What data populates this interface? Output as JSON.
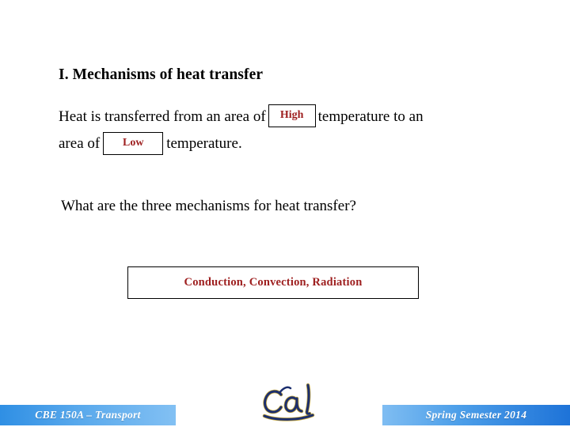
{
  "slide": {
    "title": "I. Mechanisms of heat transfer",
    "body": {
      "line1_part1": "Heat is transferred from an area of",
      "blank_high": "High",
      "line1_part2": "temperature to an",
      "line2_part1": "area of",
      "blank_low": "Low",
      "line2_part2": "temperature."
    },
    "question": "What are the three mechanisms for heat transfer?",
    "answer": "Conduction, Convection, Radiation"
  },
  "footer": {
    "course": "CBE 150A – Transport",
    "term": "Spring Semester 2014",
    "logo_text": "Cal"
  },
  "colors": {
    "answer_red": "#9e2020",
    "footer_blue_start": "#2f8fe4",
    "footer_blue_end": "#1e73d8",
    "logo_navy": "#1c2f6e",
    "logo_gold": "#c8a93c",
    "text_black": "#000000",
    "background": "#ffffff"
  }
}
